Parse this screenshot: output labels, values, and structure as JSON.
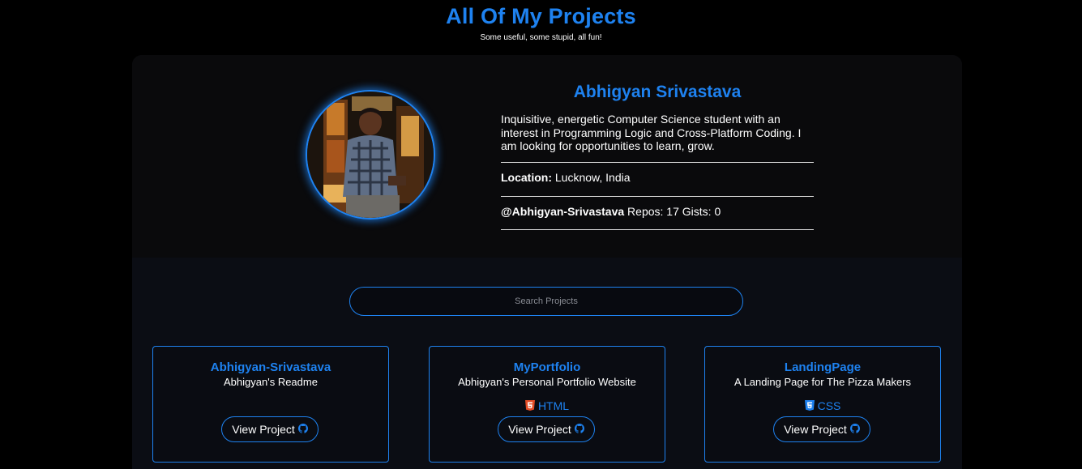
{
  "header": {
    "title": "All Of My Projects",
    "subtitle": "Some useful, some stupid, all fun!"
  },
  "profile": {
    "name": "Abhigyan Srivastava",
    "bio": "Inquisitive, energetic Computer Science student with an interest in Programming Logic and Cross-Platform Coding. I am looking for opportunities to learn, grow.",
    "location_label": "Location:",
    "location": "Lucknow, India",
    "handle": "@Abhigyan-Srivastava",
    "repos_label": "Repos:",
    "repos": "17",
    "gists_label": "Gists:",
    "gists": "0",
    "avatar_icon": "profile-photo"
  },
  "search": {
    "placeholder": "Search Projects",
    "value": ""
  },
  "projects": [
    {
      "title": "Abhigyan-Srivastava",
      "description": "Abhigyan's Readme",
      "language": "",
      "language_icon": "",
      "button_label": "View Project",
      "button_icon": "github-icon"
    },
    {
      "title": "MyPortfolio",
      "description": "Abhigyan's Personal Portfolio Website",
      "language": "HTML",
      "language_icon": "html5-icon",
      "button_label": "View Project",
      "button_icon": "github-icon"
    },
    {
      "title": "LandingPage",
      "description": "A Landing Page for The Pizza Makers",
      "language": "CSS",
      "language_icon": "css3-icon",
      "button_label": "View Project",
      "button_icon": "github-icon"
    }
  ],
  "colors": {
    "accent": "#1e82f0",
    "background": "#000000",
    "panel": "#0b0d14",
    "html_icon": "#e44d26",
    "css_icon": "#1e82f0"
  }
}
